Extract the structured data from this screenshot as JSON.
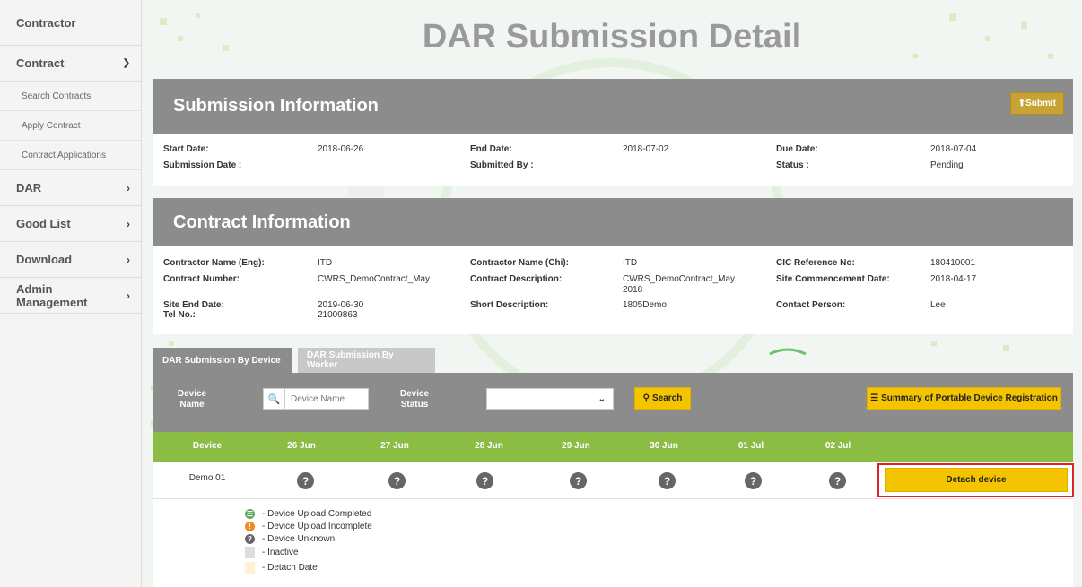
{
  "sidebar": {
    "items": [
      {
        "label": "Contractor"
      },
      {
        "label": "Contract"
      },
      {
        "label": "Search Contracts"
      },
      {
        "label": "Apply Contract"
      },
      {
        "label": "Contract Applications"
      },
      {
        "label": "DAR"
      },
      {
        "label": "Good List"
      },
      {
        "label": "Download"
      },
      {
        "label": "Admin Management"
      }
    ]
  },
  "page": {
    "title": "DAR Submission Detail"
  },
  "submission": {
    "heading": "Submission Information",
    "submit_label": "Submit",
    "start_date_label": "Start Date:",
    "start_date": "2018-06-26",
    "end_date_label": "End Date:",
    "end_date": "2018-07-02",
    "due_date_label": "Due Date:",
    "due_date": "2018-07-04",
    "submission_date_label": "Submission Date :",
    "submission_date": "",
    "submitted_by_label": "Submitted By :",
    "submitted_by": "",
    "status_label": "Status :",
    "status": "Pending"
  },
  "contract": {
    "heading": "Contract Information",
    "contractor_eng_label": "Contractor Name (Eng):",
    "contractor_eng": "ITD",
    "contractor_chi_label": "Contractor Name (Chi):",
    "contractor_chi": "ITD",
    "cic_label": "CIC Reference No:",
    "cic": "180410001",
    "number_label": "Contract Number:",
    "number": "CWRS_DemoContract_May",
    "description_label": "Contract Description:",
    "description_1": "CWRS_DemoContract_May",
    "description_2": "2018",
    "commencement_label": "Site Commencement Date:",
    "commencement": "2018-04-17",
    "site_end_label": "Site End Date:",
    "site_end": "2019-06-30",
    "short_desc_label": "Short Description:",
    "short_desc": "1805Demo",
    "contact_label": "Contact Person:",
    "contact": "Lee",
    "tel_label": "Tel No.:",
    "tel": "21009863"
  },
  "tabs": [
    {
      "label": "DAR Submission By Device"
    },
    {
      "label": "DAR Submission By Worker"
    }
  ],
  "filters": {
    "device_name_label_1": "Device",
    "device_name_label_2": "Name",
    "device_name_placeholder": "Device Name",
    "device_status_label_1": "Device",
    "device_status_label_2": "Status",
    "device_status_value": "",
    "search_label": "Search",
    "summary_label": "Summary of Portable Device Registration"
  },
  "table": {
    "columns": [
      "Device",
      "26 Jun",
      "27 Jun",
      "28 Jun",
      "29 Jun",
      "30 Jun",
      "01 Jul",
      "02 Jul"
    ],
    "rows": [
      {
        "device": "Demo 01",
        "statuses": [
          "?",
          "?",
          "?",
          "?",
          "?",
          "?",
          "?"
        ],
        "action": "Detach device"
      }
    ]
  },
  "legend": [
    {
      "label": "- Device Upload Completed",
      "color": "#5ba85b"
    },
    {
      "label": "- Device Upload Incomplete",
      "color": "#f08a24"
    },
    {
      "label": "- Device Unknown",
      "color": "#666666"
    },
    {
      "label": "- Inactive",
      "color": "#dddddd"
    },
    {
      "label": "- Detach Date",
      "color": "#fdf3d0"
    }
  ]
}
